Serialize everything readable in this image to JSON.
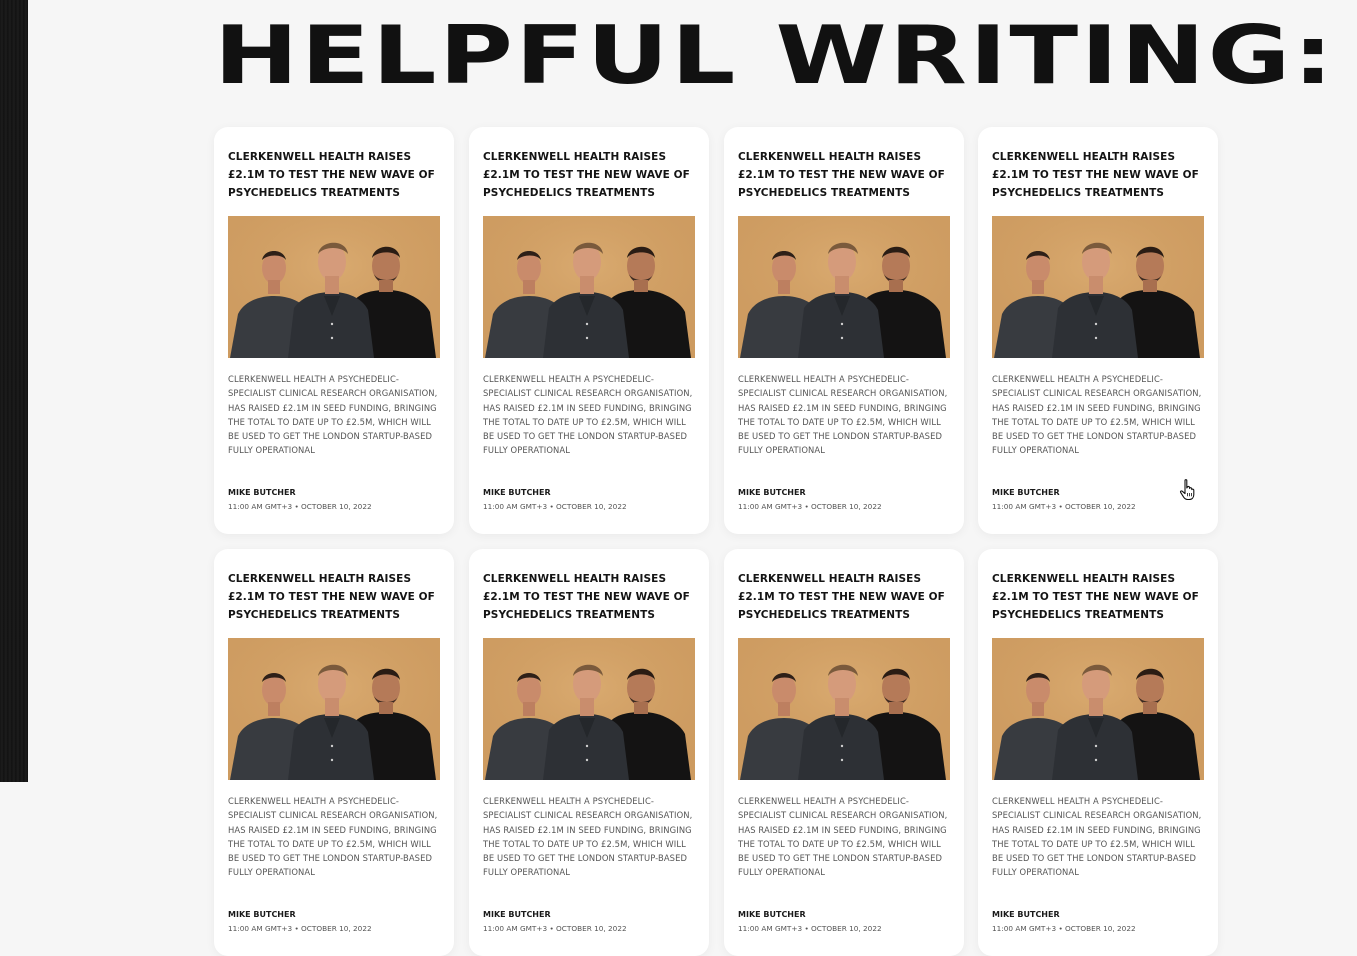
{
  "page": {
    "heading": "HELPFUL WRITING:"
  },
  "articles": [
    {
      "title": "CLERKENWELL HEALTH RAISES £2.1M TO TEST THE NEW WAVE OF PSYCHEDELICS TREATMENTS",
      "excerpt": "CLERKENWELL HEALTH A PSYCHEDELIC-SPECIALIST CLINICAL RESEARCH ORGANISATION, HAS RAISED £2.1M IN SEED FUNDING, BRINGING THE TOTAL TO DATE UP TO £2.5M, WHICH WILL BE USED TO GET THE LONDON STARTUP-BASED FULLY OPERATIONAL",
      "author": "MIKE BUTCHER",
      "meta": "11:00 AM GMT+3 • OCTOBER 10, 2022"
    },
    {
      "title": "CLERKENWELL HEALTH RAISES £2.1M TO TEST THE NEW WAVE OF PSYCHEDELICS TREATMENTS",
      "excerpt": "CLERKENWELL HEALTH A PSYCHEDELIC-SPECIALIST CLINICAL RESEARCH ORGANISATION, HAS RAISED £2.1M IN SEED FUNDING, BRINGING THE TOTAL TO DATE UP TO £2.5M, WHICH WILL BE USED TO GET THE LONDON STARTUP-BASED FULLY OPERATIONAL",
      "author": "MIKE BUTCHER",
      "meta": "11:00 AM GMT+3 • OCTOBER 10, 2022"
    },
    {
      "title": "CLERKENWELL HEALTH RAISES £2.1M TO TEST THE NEW WAVE OF PSYCHEDELICS TREATMENTS",
      "excerpt": "CLERKENWELL HEALTH A PSYCHEDELIC-SPECIALIST CLINICAL RESEARCH ORGANISATION, HAS RAISED £2.1M IN SEED FUNDING, BRINGING THE TOTAL TO DATE UP TO £2.5M, WHICH WILL BE USED TO GET THE LONDON STARTUP-BASED FULLY OPERATIONAL",
      "author": "MIKE BUTCHER",
      "meta": "11:00 AM GMT+3 • OCTOBER 10, 2022"
    },
    {
      "title": "CLERKENWELL HEALTH RAISES £2.1M TO TEST THE NEW WAVE OF PSYCHEDELICS TREATMENTS",
      "excerpt": "CLERKENWELL HEALTH A PSYCHEDELIC-SPECIALIST CLINICAL RESEARCH ORGANISATION, HAS RAISED £2.1M IN SEED FUNDING, BRINGING THE TOTAL TO DATE UP TO £2.5M, WHICH WILL BE USED TO GET THE LONDON STARTUP-BASED FULLY OPERATIONAL",
      "author": "MIKE BUTCHER",
      "meta": "11:00 AM GMT+3 • OCTOBER 10, 2022"
    },
    {
      "title": "CLERKENWELL HEALTH RAISES £2.1M TO TEST THE NEW WAVE OF PSYCHEDELICS TREATMENTS",
      "excerpt": "CLERKENWELL HEALTH A PSYCHEDELIC-SPECIALIST CLINICAL RESEARCH ORGANISATION, HAS RAISED £2.1M IN SEED FUNDING, BRINGING THE TOTAL TO DATE UP TO £2.5M, WHICH WILL BE USED TO GET THE LONDON STARTUP-BASED FULLY OPERATIONAL",
      "author": "MIKE BUTCHER",
      "meta": "11:00 AM GMT+3 • OCTOBER 10, 2022"
    },
    {
      "title": "CLERKENWELL HEALTH RAISES £2.1M TO TEST THE NEW WAVE OF PSYCHEDELICS TREATMENTS",
      "excerpt": "CLERKENWELL HEALTH A PSYCHEDELIC-SPECIALIST CLINICAL RESEARCH ORGANISATION, HAS RAISED £2.1M IN SEED FUNDING, BRINGING THE TOTAL TO DATE UP TO £2.5M, WHICH WILL BE USED TO GET THE LONDON STARTUP-BASED FULLY OPERATIONAL",
      "author": "MIKE BUTCHER",
      "meta": "11:00 AM GMT+3 • OCTOBER 10, 2022"
    },
    {
      "title": "CLERKENWELL HEALTH RAISES £2.1M TO TEST THE NEW WAVE OF PSYCHEDELICS TREATMENTS",
      "excerpt": "CLERKENWELL HEALTH A PSYCHEDELIC-SPECIALIST CLINICAL RESEARCH ORGANISATION, HAS RAISED £2.1M IN SEED FUNDING, BRINGING THE TOTAL TO DATE UP TO £2.5M, WHICH WILL BE USED TO GET THE LONDON STARTUP-BASED FULLY OPERATIONAL",
      "author": "MIKE BUTCHER",
      "meta": "11:00 AM GMT+3 • OCTOBER 10, 2022"
    },
    {
      "title": "CLERKENWELL HEALTH RAISES £2.1M TO TEST THE NEW WAVE OF PSYCHEDELICS TREATMENTS",
      "excerpt": "CLERKENWELL HEALTH A PSYCHEDELIC-SPECIALIST CLINICAL RESEARCH ORGANISATION, HAS RAISED £2.1M IN SEED FUNDING, BRINGING THE TOTAL TO DATE UP TO £2.5M, WHICH WILL BE USED TO GET THE LONDON STARTUP-BASED FULLY OPERATIONAL",
      "author": "MIKE BUTCHER",
      "meta": "11:00 AM GMT+3 • OCTOBER 10, 2022"
    }
  ],
  "image": {
    "name": "three-men-portrait",
    "background_color": "#d3a266"
  },
  "cursor": {
    "icon": "hand-pointer-icon"
  },
  "colors": {
    "page_background": "#f6f6f6",
    "card_background": "#ffffff",
    "heading_text": "#111111",
    "body_text": "#555555",
    "left_strip": "#141414"
  }
}
